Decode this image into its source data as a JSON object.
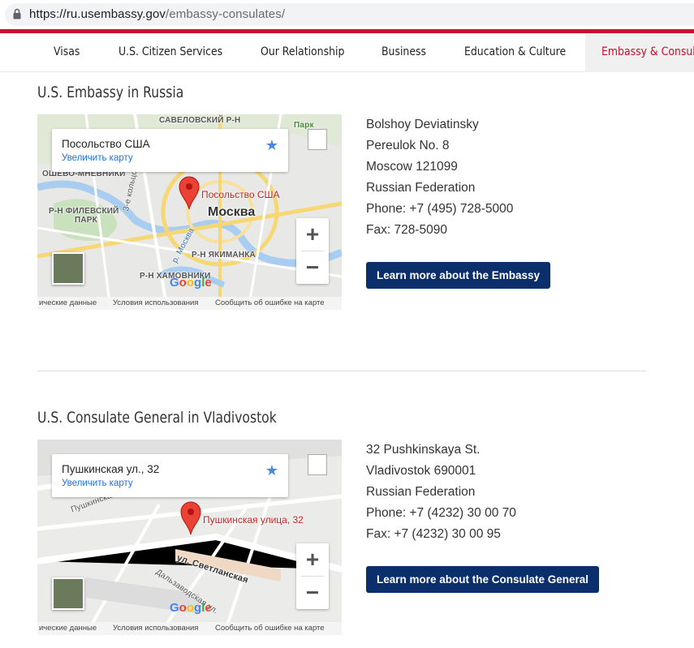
{
  "browser": {
    "url_host": "https://ru.usembassy.gov",
    "url_path": "/embassy-consulates/"
  },
  "nav": {
    "items": [
      {
        "label": "Visas"
      },
      {
        "label": "U.S. Citizen Services"
      },
      {
        "label": "Our Relationship"
      },
      {
        "label": "Business"
      },
      {
        "label": "Education & Culture"
      },
      {
        "label": "Embassy & Consulates",
        "active": true
      }
    ]
  },
  "colors": {
    "accent_red": "#c8102e",
    "button_navy": "#0a2f6b"
  },
  "sections": [
    {
      "title": "U.S. Embassy in Russia",
      "map": {
        "place_name": "Посольство США",
        "enlarge_link": "Увеличить карту",
        "pin_label": "Посольство США",
        "city_label": "Москва",
        "labels": [
          "САВЕЛОВСКИЙ Р-Н",
          "Парк",
          "ОШЕВО-МНЕВНИКИ",
          "Р-Н ФИЛЕВСКИЙ",
          "ПАРК",
          "3-е кольцо",
          "р. Москва",
          "Р-Н ЯКИМАНКА",
          "Р-Н ХАМОВНИКИ"
        ],
        "footer": [
          "ические данные",
          "Условия использования",
          "Сообщить об ошибке на карте"
        ],
        "google_logo": "Google",
        "icons": [
          "star-icon",
          "fullscreen-icon",
          "zoom-in-icon",
          "zoom-out-icon",
          "map-pin-icon"
        ]
      },
      "address_lines": [
        "Bolshoy Deviatinsky",
        "Pereulok No. 8",
        "Moscow 121099",
        "Russian Federation",
        "Phone: +7 (495) 728-5000",
        "Fax: 728-5090"
      ],
      "button": "Learn more about the Embassy"
    },
    {
      "title": "U.S. Consulate General in Vladivostok",
      "map": {
        "place_name": "Пушкинская ул., 32",
        "enlarge_link": "Увеличить карту",
        "pin_label": "Пушкинская улица, 32",
        "labels": [
          "Пушкинская ул.",
          "ул. Светланская",
          "Дальзаводская ул."
        ],
        "footer": [
          "ические данные",
          "Условия использования",
          "Сообщить об ошибке на карте"
        ],
        "google_logo": "Google",
        "icons": [
          "star-icon",
          "fullscreen-icon",
          "zoom-in-icon",
          "zoom-out-icon",
          "map-pin-icon"
        ]
      },
      "address_lines": [
        "32 Pushkinskaya St.",
        "Vladivostok 690001",
        "Russian Federation",
        "Phone: +7 (4232) 30 00 70",
        "Fax: +7 (4232) 30 00 95"
      ],
      "button": "Learn more about the Consulate General"
    }
  ]
}
